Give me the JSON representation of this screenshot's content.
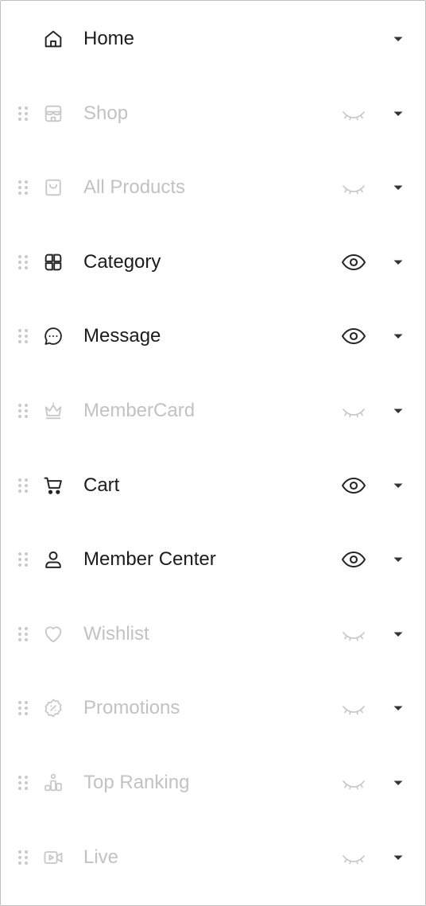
{
  "colors": {
    "enabled_text": "#1c1c1c",
    "disabled_text": "#c2c2c2",
    "drag_handle": "#c9c9c9",
    "caret": "#333333",
    "border": "#bfbfbf"
  },
  "nav_items": [
    {
      "label": "Home",
      "icon": "home-icon",
      "visible": true,
      "draggable": false,
      "visibility_toggle": false
    },
    {
      "label": "Shop",
      "icon": "shop-icon",
      "visible": false,
      "draggable": true,
      "visibility_toggle": true
    },
    {
      "label": "All Products",
      "icon": "shopping-bag-icon",
      "visible": false,
      "draggable": true,
      "visibility_toggle": true
    },
    {
      "label": "Category",
      "icon": "category-grid-icon",
      "visible": true,
      "draggable": true,
      "visibility_toggle": true
    },
    {
      "label": "Message",
      "icon": "chat-bubble-icon",
      "visible": true,
      "draggable": true,
      "visibility_toggle": true
    },
    {
      "label": "MemberCard",
      "icon": "crown-icon",
      "visible": false,
      "draggable": true,
      "visibility_toggle": true
    },
    {
      "label": "Cart",
      "icon": "cart-icon",
      "visible": true,
      "draggable": true,
      "visibility_toggle": true
    },
    {
      "label": "Member Center",
      "icon": "user-icon",
      "visible": true,
      "draggable": true,
      "visibility_toggle": true
    },
    {
      "label": "Wishlist",
      "icon": "heart-icon",
      "visible": false,
      "draggable": true,
      "visibility_toggle": true
    },
    {
      "label": "Promotions",
      "icon": "discount-badge-icon",
      "visible": false,
      "draggable": true,
      "visibility_toggle": true
    },
    {
      "label": "Top Ranking",
      "icon": "ranking-podium-icon",
      "visible": false,
      "draggable": true,
      "visibility_toggle": true
    },
    {
      "label": "Live",
      "icon": "video-camera-icon",
      "visible": false,
      "draggable": true,
      "visibility_toggle": true
    }
  ]
}
